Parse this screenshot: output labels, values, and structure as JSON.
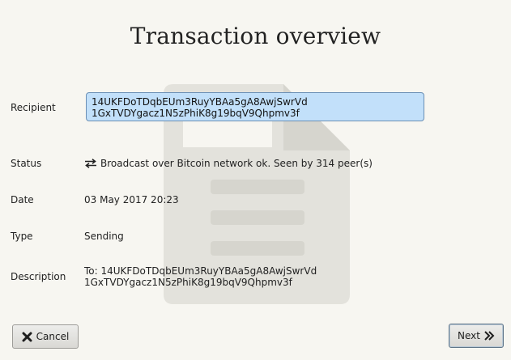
{
  "title": "Transaction overview",
  "fields": {
    "recipient_label": "Recipient",
    "recipient_line1": "14UKFDoTDqbEUm3RuyYBAa5gA8AwjSwrVd",
    "recipient_line2": "1GxTVDYgacz1N5zPhiK8g19bqV9Qhpmv3f",
    "status_label": "Status",
    "status_value": "Broadcast over Bitcoin network ok. Seen by 314 peer(s)",
    "date_label": "Date",
    "date_value": "03 May 2017 20:23",
    "type_label": "Type",
    "type_value": "Sending",
    "description_label": "Description",
    "description_line1": "To: 14UKFDoTDqbEUm3RuyYBAa5gA8AwjSwrVd",
    "description_line2": "1GxTVDYgacz1N5zPhiK8g19bqV9Qhpmv3f"
  },
  "buttons": {
    "cancel_label": "Cancel",
    "next_label": "Next"
  },
  "icons": {
    "status": "transfer-arrows-icon",
    "cancel": "close-icon",
    "next": "double-chevron-right-icon",
    "watermark": "document-icon"
  },
  "colors": {
    "background": "#f7f6f1",
    "recipient_highlight": "#c2e0fa",
    "watermark": "#e3e2dc"
  }
}
